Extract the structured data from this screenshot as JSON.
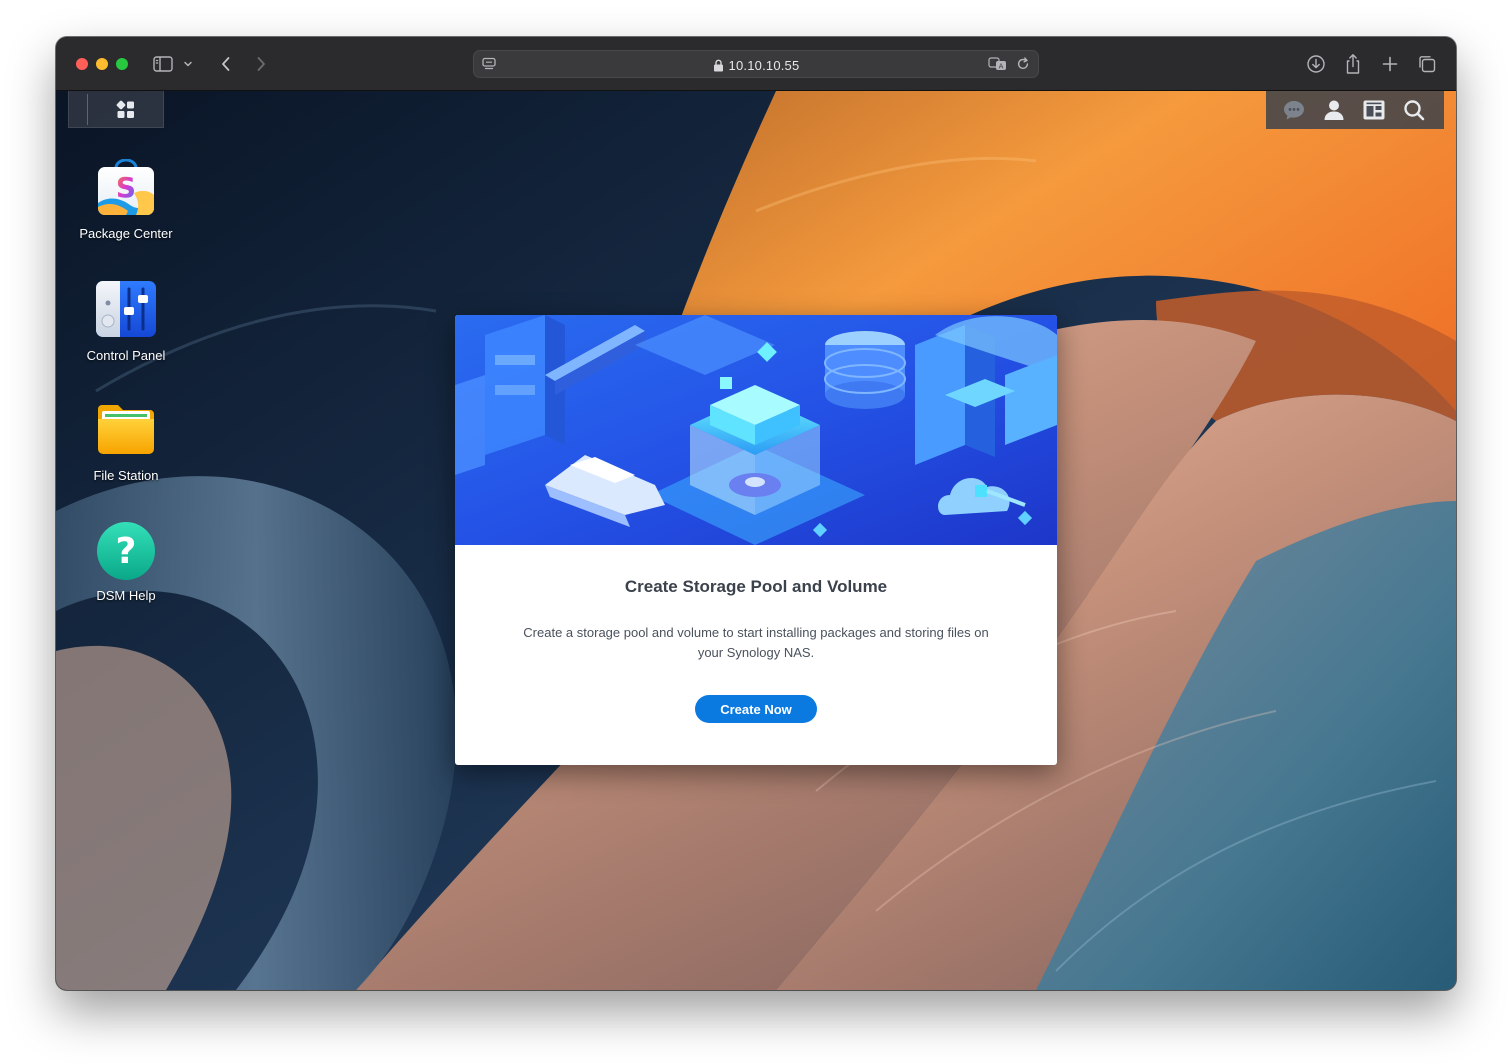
{
  "browser": {
    "url": "10.10.10.55"
  },
  "desktop": {
    "icons": [
      {
        "label": "Package Center",
        "icon": "package-center-icon"
      },
      {
        "label": "Control Panel",
        "icon": "control-panel-icon"
      },
      {
        "label": "File Station",
        "icon": "file-station-icon"
      },
      {
        "label": "DSM Help",
        "icon": "dsm-help-icon"
      }
    ],
    "tray": [
      "chat-icon",
      "user-icon",
      "widgets-icon",
      "search-icon"
    ]
  },
  "dialog": {
    "title": "Create Storage Pool and Volume",
    "description": "Create a storage pool and volume to start installing packages and storing files on your Synology NAS.",
    "button_label": "Create Now"
  },
  "colors": {
    "accent": "#0b7ae0",
    "toolbar": "#2b2b2e"
  }
}
